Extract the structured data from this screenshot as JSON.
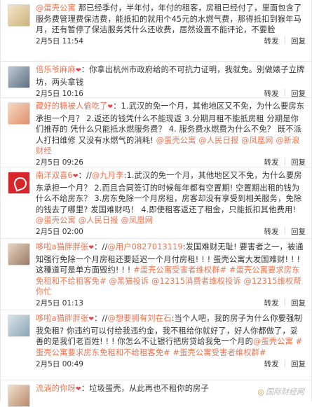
{
  "actions": {
    "forward": "转发",
    "reply": "回复"
  },
  "comments": [
    {
      "user": "",
      "heart": "",
      "text_parts": [
        {
          "t": "@",
          "link": true
        },
        {
          "t": "蛋壳公寓",
          "link": true
        },
        {
          "t": " 那已经季付，半年付，年付的租客，房租已经付了，里面包含了服务费管理费保洁费，能抵扣的就用个45元的水燃气费，那得抵扣到猴年马月，还有暂停了保洁服务凭什么还收费，居然设置不能评论，不要脸",
          "link": false
        }
      ],
      "date": "2月5日 11:54"
    },
    {
      "user": "倍乐爷麻麻",
      "heart": "❤",
      "text_parts": [
        {
          "t": "：你拿出杭州市政府给的不可抗力证明，我就免。别做婊子立牌坊，两头拿钱",
          "link": false
        }
      ],
      "date": "2月5日 10:16"
    },
    {
      "user": "藏好的糖被人偷吃了",
      "heart": "❤",
      "text_parts": [
        {
          "t": "：1.武汉的免一个月，其他地区又不免，为什么要房东承担一个月？ 2.返还的钱凭什么不能现返 3.分期月租不能抵房租 分期是你们推荐的 凭什么只能抵水燃服务费？ 4. 服务费水燃费为什么不免？ 既不派人打扫维修 又没有水燃气的消耗! ",
          "link": false
        },
        {
          "t": "@蛋壳公寓",
          "link": true
        },
        {
          "t": " ",
          "link": false
        },
        {
          "t": "@人民日报",
          "link": true
        },
        {
          "t": " ",
          "link": false
        },
        {
          "t": "@凤凰网",
          "link": true
        },
        {
          "t": " ",
          "link": false
        },
        {
          "t": "@新浪财经",
          "link": true
        }
      ],
      "date": "2月5日 09:26"
    },
    {
      "user": "南洋双喜6",
      "heart": "❤",
      "text_parts": [
        {
          "t": "：//",
          "link": false
        },
        {
          "t": "@九月李",
          "link": true
        },
        {
          "t": ":1.武汉的免一个月，其他地区又不免，为什么要房东承担一个月？ 2.而且合同签订的时候每年都有空置期! 空置期出租的钱为什么不给房东？ 3.房东免除一个月房租，房客却没有享受到相关服务，免除的钱去了哪里? 发国难财吗！ 4.即使租客返还了租金，只能抵扣其他费用! ",
          "link": false
        },
        {
          "t": "@蛋壳公寓",
          "link": true
        },
        {
          "t": " ",
          "link": false
        },
        {
          "t": "@人民日报",
          "link": true
        },
        {
          "t": " ",
          "link": false
        },
        {
          "t": "@凤凰网",
          "link": true
        }
      ],
      "date": "2月5日 02:00"
    },
    {
      "user": "哆啦a猫胖胖张",
      "heart": "❤",
      "text_parts": [
        {
          "t": "：//",
          "link": false
        },
        {
          "t": "@用户0827013119",
          "link": true
        },
        {
          "t": ":发国难财无耻! 要害者之一，被通知强行免除一个月房租还要延迟一个月付房租! ! ! 蛋壳公寓大发国难财! ! ! 这種道可是单方面毁约! ! ! ",
          "link": false
        },
        {
          "t": "#蛋壳公寓受害者维权群#",
          "link": true
        },
        {
          "t": " ",
          "link": false
        },
        {
          "t": "#蛋壳公寓要求房东免租和不给租客免#",
          "link": true
        },
        {
          "t": " ",
          "link": false
        },
        {
          "t": "@黑猫投诉",
          "link": true
        },
        {
          "t": " ",
          "link": false
        },
        {
          "t": "@12315消费者维权投诉",
          "link": true
        },
        {
          "t": " ",
          "link": false
        },
        {
          "t": "@12315维权帮你忙",
          "link": true
        }
      ],
      "date": "2月5日 01:13"
    },
    {
      "user": "哆啦a猫胖胖张",
      "heart": "❤",
      "text_parts": [
        {
          "t": "：//",
          "link": false
        },
        {
          "t": "@想要拥有刘在石",
          "link": true
        },
        {
          "t": ":当个人吧，我的房子为什么你要强制我免租? 你违约可以付给我违约金，我不租给你就好了，好人你都做了，妥善的是我们老百姓! ! ! 你怎么不让银行把房贷给我免一个月的",
          "link": false
        },
        {
          "t": "@蛋壳公寓",
          "link": true
        },
        {
          "t": " ",
          "link": false
        },
        {
          "t": "#蛋壳公寓要求房东免租和不给租客免#",
          "link": true
        },
        {
          "t": " ",
          "link": false
        },
        {
          "t": "#蛋壳公寓受害者维权群#",
          "link": true
        }
      ],
      "date": "2月5日 00:49"
    },
    {
      "user": "流淌的你呀",
      "heart": "❤",
      "text_parts": [
        {
          "t": "：垃圾蛋壳，从此再也不租你的房子",
          "link": false
        }
      ],
      "date": ""
    }
  ],
  "watermark": "国际财经网",
  "colors": {
    "link": "#eb7350",
    "text": "#333333",
    "divider": "#e6e6e6"
  }
}
